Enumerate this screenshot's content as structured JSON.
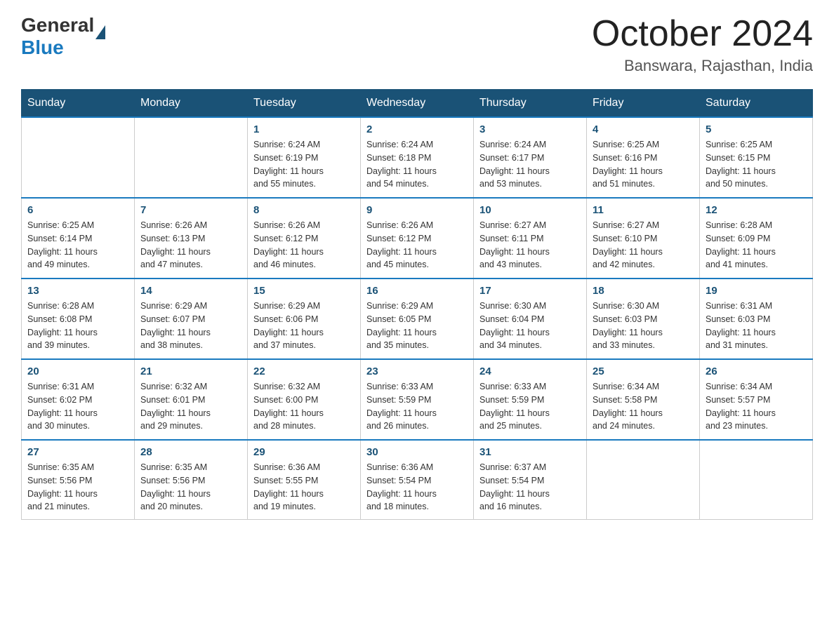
{
  "header": {
    "logo_general": "General",
    "logo_blue": "Blue",
    "month": "October 2024",
    "location": "Banswara, Rajasthan, India"
  },
  "days_of_week": [
    "Sunday",
    "Monday",
    "Tuesday",
    "Wednesday",
    "Thursday",
    "Friday",
    "Saturday"
  ],
  "weeks": [
    [
      {
        "day": "",
        "info": ""
      },
      {
        "day": "",
        "info": ""
      },
      {
        "day": "1",
        "info": "Sunrise: 6:24 AM\nSunset: 6:19 PM\nDaylight: 11 hours\nand 55 minutes."
      },
      {
        "day": "2",
        "info": "Sunrise: 6:24 AM\nSunset: 6:18 PM\nDaylight: 11 hours\nand 54 minutes."
      },
      {
        "day": "3",
        "info": "Sunrise: 6:24 AM\nSunset: 6:17 PM\nDaylight: 11 hours\nand 53 minutes."
      },
      {
        "day": "4",
        "info": "Sunrise: 6:25 AM\nSunset: 6:16 PM\nDaylight: 11 hours\nand 51 minutes."
      },
      {
        "day": "5",
        "info": "Sunrise: 6:25 AM\nSunset: 6:15 PM\nDaylight: 11 hours\nand 50 minutes."
      }
    ],
    [
      {
        "day": "6",
        "info": "Sunrise: 6:25 AM\nSunset: 6:14 PM\nDaylight: 11 hours\nand 49 minutes."
      },
      {
        "day": "7",
        "info": "Sunrise: 6:26 AM\nSunset: 6:13 PM\nDaylight: 11 hours\nand 47 minutes."
      },
      {
        "day": "8",
        "info": "Sunrise: 6:26 AM\nSunset: 6:12 PM\nDaylight: 11 hours\nand 46 minutes."
      },
      {
        "day": "9",
        "info": "Sunrise: 6:26 AM\nSunset: 6:12 PM\nDaylight: 11 hours\nand 45 minutes."
      },
      {
        "day": "10",
        "info": "Sunrise: 6:27 AM\nSunset: 6:11 PM\nDaylight: 11 hours\nand 43 minutes."
      },
      {
        "day": "11",
        "info": "Sunrise: 6:27 AM\nSunset: 6:10 PM\nDaylight: 11 hours\nand 42 minutes."
      },
      {
        "day": "12",
        "info": "Sunrise: 6:28 AM\nSunset: 6:09 PM\nDaylight: 11 hours\nand 41 minutes."
      }
    ],
    [
      {
        "day": "13",
        "info": "Sunrise: 6:28 AM\nSunset: 6:08 PM\nDaylight: 11 hours\nand 39 minutes."
      },
      {
        "day": "14",
        "info": "Sunrise: 6:29 AM\nSunset: 6:07 PM\nDaylight: 11 hours\nand 38 minutes."
      },
      {
        "day": "15",
        "info": "Sunrise: 6:29 AM\nSunset: 6:06 PM\nDaylight: 11 hours\nand 37 minutes."
      },
      {
        "day": "16",
        "info": "Sunrise: 6:29 AM\nSunset: 6:05 PM\nDaylight: 11 hours\nand 35 minutes."
      },
      {
        "day": "17",
        "info": "Sunrise: 6:30 AM\nSunset: 6:04 PM\nDaylight: 11 hours\nand 34 minutes."
      },
      {
        "day": "18",
        "info": "Sunrise: 6:30 AM\nSunset: 6:03 PM\nDaylight: 11 hours\nand 33 minutes."
      },
      {
        "day": "19",
        "info": "Sunrise: 6:31 AM\nSunset: 6:03 PM\nDaylight: 11 hours\nand 31 minutes."
      }
    ],
    [
      {
        "day": "20",
        "info": "Sunrise: 6:31 AM\nSunset: 6:02 PM\nDaylight: 11 hours\nand 30 minutes."
      },
      {
        "day": "21",
        "info": "Sunrise: 6:32 AM\nSunset: 6:01 PM\nDaylight: 11 hours\nand 29 minutes."
      },
      {
        "day": "22",
        "info": "Sunrise: 6:32 AM\nSunset: 6:00 PM\nDaylight: 11 hours\nand 28 minutes."
      },
      {
        "day": "23",
        "info": "Sunrise: 6:33 AM\nSunset: 5:59 PM\nDaylight: 11 hours\nand 26 minutes."
      },
      {
        "day": "24",
        "info": "Sunrise: 6:33 AM\nSunset: 5:59 PM\nDaylight: 11 hours\nand 25 minutes."
      },
      {
        "day": "25",
        "info": "Sunrise: 6:34 AM\nSunset: 5:58 PM\nDaylight: 11 hours\nand 24 minutes."
      },
      {
        "day": "26",
        "info": "Sunrise: 6:34 AM\nSunset: 5:57 PM\nDaylight: 11 hours\nand 23 minutes."
      }
    ],
    [
      {
        "day": "27",
        "info": "Sunrise: 6:35 AM\nSunset: 5:56 PM\nDaylight: 11 hours\nand 21 minutes."
      },
      {
        "day": "28",
        "info": "Sunrise: 6:35 AM\nSunset: 5:56 PM\nDaylight: 11 hours\nand 20 minutes."
      },
      {
        "day": "29",
        "info": "Sunrise: 6:36 AM\nSunset: 5:55 PM\nDaylight: 11 hours\nand 19 minutes."
      },
      {
        "day": "30",
        "info": "Sunrise: 6:36 AM\nSunset: 5:54 PM\nDaylight: 11 hours\nand 18 minutes."
      },
      {
        "day": "31",
        "info": "Sunrise: 6:37 AM\nSunset: 5:54 PM\nDaylight: 11 hours\nand 16 minutes."
      },
      {
        "day": "",
        "info": ""
      },
      {
        "day": "",
        "info": ""
      }
    ]
  ]
}
